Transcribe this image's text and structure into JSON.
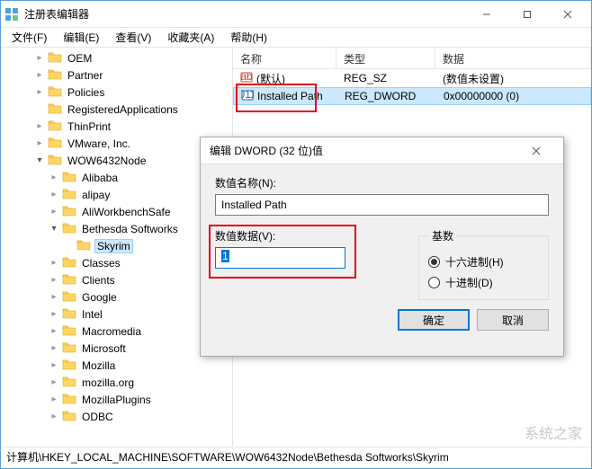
{
  "window": {
    "title": "注册表编辑器"
  },
  "menu": [
    "文件(F)",
    "编辑(E)",
    "查看(V)",
    "收藏夹(A)",
    "帮助(H)"
  ],
  "tree": [
    {
      "depth": 2,
      "chev": "closed",
      "label": "OEM"
    },
    {
      "depth": 2,
      "chev": "closed",
      "label": "Partner"
    },
    {
      "depth": 2,
      "chev": "closed",
      "label": "Policies"
    },
    {
      "depth": 2,
      "chev": "none",
      "label": "RegisteredApplications"
    },
    {
      "depth": 2,
      "chev": "closed",
      "label": "ThinPrint"
    },
    {
      "depth": 2,
      "chev": "closed",
      "label": "VMware, Inc."
    },
    {
      "depth": 2,
      "chev": "open",
      "label": "WOW6432Node"
    },
    {
      "depth": 3,
      "chev": "closed",
      "label": "Alibaba"
    },
    {
      "depth": 3,
      "chev": "closed",
      "label": "alipay"
    },
    {
      "depth": 3,
      "chev": "closed",
      "label": "AliWorkbenchSafe"
    },
    {
      "depth": 3,
      "chev": "open",
      "label": "Bethesda Softworks"
    },
    {
      "depth": 4,
      "chev": "none",
      "label": "Skyrim",
      "selected": true
    },
    {
      "depth": 3,
      "chev": "closed",
      "label": "Classes"
    },
    {
      "depth": 3,
      "chev": "closed",
      "label": "Clients"
    },
    {
      "depth": 3,
      "chev": "closed",
      "label": "Google"
    },
    {
      "depth": 3,
      "chev": "closed",
      "label": "Intel"
    },
    {
      "depth": 3,
      "chev": "closed",
      "label": "Macromedia"
    },
    {
      "depth": 3,
      "chev": "closed",
      "label": "Microsoft"
    },
    {
      "depth": 3,
      "chev": "closed",
      "label": "Mozilla"
    },
    {
      "depth": 3,
      "chev": "closed",
      "label": "mozilla.org"
    },
    {
      "depth": 3,
      "chev": "closed",
      "label": "MozillaPlugins"
    },
    {
      "depth": 3,
      "chev": "closed",
      "label": "ODBC"
    }
  ],
  "list": {
    "columns": [
      "名称",
      "类型",
      "数据"
    ],
    "rows": [
      {
        "icon": "sz",
        "name": "(默认)",
        "type": "REG_SZ",
        "data": "(数值未设置)",
        "selected": false
      },
      {
        "icon": "dw",
        "name": "Installed Path",
        "type": "REG_DWORD",
        "data": "0x00000000 (0)",
        "selected": true
      }
    ]
  },
  "dialog": {
    "title": "编辑 DWORD (32 位)值",
    "name_label": "数值名称(N):",
    "name_value": "Installed Path",
    "value_label": "数值数据(V):",
    "value_data": "1",
    "radix_legend": "基数",
    "radix_hex": "十六进制(H)",
    "radix_dec": "十进制(D)",
    "ok": "确定",
    "cancel": "取消"
  },
  "statusbar": "计算机\\HKEY_LOCAL_MACHINE\\SOFTWARE\\WOW6432Node\\Bethesda Softworks\\Skyrim",
  "watermark": "系统之家"
}
